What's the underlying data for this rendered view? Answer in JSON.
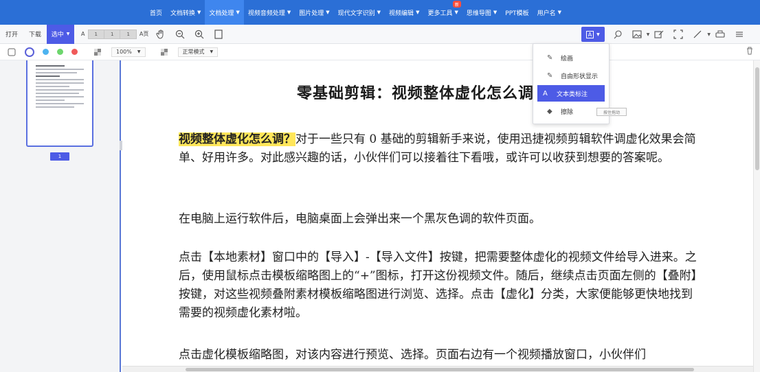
{
  "topnav": {
    "items": [
      {
        "label": "首页",
        "caret": false,
        "active": false
      },
      {
        "label": "文档转换",
        "caret": true,
        "active": false
      },
      {
        "label": "文档处理",
        "caret": true,
        "active": true
      },
      {
        "label": "视频音频处理",
        "caret": true,
        "active": false
      },
      {
        "label": "图片处理",
        "caret": true,
        "active": false
      },
      {
        "label": "现代文字识别",
        "caret": true,
        "active": false
      },
      {
        "label": "视频编辑",
        "caret": true,
        "active": false
      },
      {
        "label": "更多工具",
        "caret": true,
        "active": false,
        "badge": "新"
      },
      {
        "label": "思维导图",
        "caret": true,
        "active": false
      },
      {
        "label": "PPT模板",
        "caret": false,
        "active": false
      },
      {
        "label": "用户名",
        "caret": true,
        "active": false
      }
    ],
    "accent": "#2b6fd6"
  },
  "toolbar1": {
    "prev": "打开",
    "next": "下载",
    "highlight": "选中",
    "zoom_label": "A",
    "seg": [
      "1",
      "1",
      "1"
    ],
    "paging": "A页"
  },
  "toolbar2": {
    "colors": [
      "#5a5fd8",
      "#4db3f0",
      "#6dd66d",
      "#f05a5a"
    ],
    "zoom": "100%",
    "mode": "正常模式"
  },
  "thumbnail": {
    "page_label": "1"
  },
  "document": {
    "title": "零基础剪辑：视频整体虚化怎么调？",
    "para1_highlight": "视频整体虚化怎么调？",
    "para1_rest": "对于一些只有 0 基础的剪辑新手来说，使用迅捷视频剪辑软件调虚化效果会简单、好用许多。对此感兴趣的话，小伙伴们可以接着往下看哦，或许可以收获到想要的答案呢。",
    "para2": "在电脑上运行软件后，电脑桌面上会弹出来一个黑灰色调的软件页面。",
    "para3": "点击【本地素材】窗口中的【导入】-【导入文件】按键，把需要整体虚化的视频文件给导入进来。之后，使用鼠标点击模板缩略图上的“+”图标，打开这份视频文件。随后，继续点击页面左侧的【叠附】按键，对这些视频叠附素材模板缩略图进行浏览、选择。点击【虚化】分类，大家便能够更快地找到需要的视频虚化素材啦。",
    "para4": "点击虚化模板缩略图，对该内容进行预览、选择。页面右边有一个视频播放窗口，小伙伴们"
  },
  "dropdown": {
    "items": [
      {
        "label": "绘画",
        "icon": "✎",
        "selected": false
      },
      {
        "label": "自由形状显示",
        "icon": "✎",
        "selected": false
      },
      {
        "label": "文本类标注",
        "icon": "A",
        "selected": true
      },
      {
        "label": "擦除",
        "icon": "◆",
        "selected": false
      }
    ],
    "tooltip": "按住拖动"
  }
}
